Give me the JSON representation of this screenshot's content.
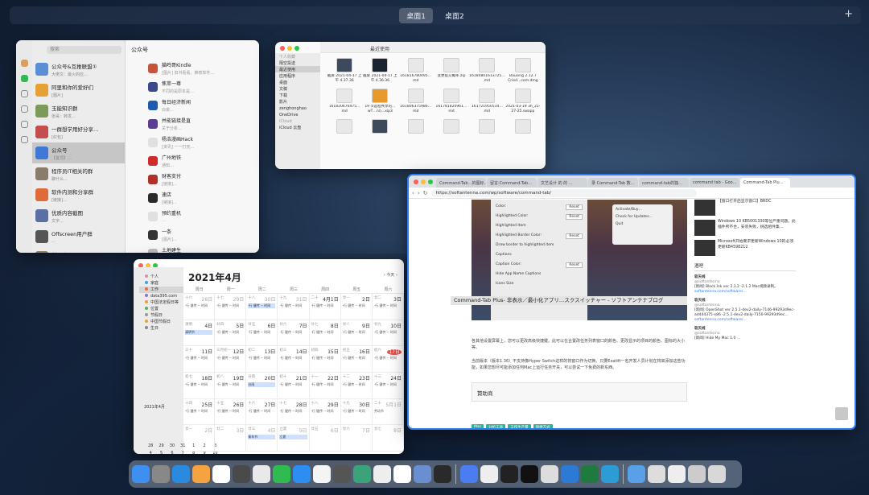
{
  "spaces": {
    "desktop1": "桌面1",
    "desktop2": "桌面2",
    "add": "+"
  },
  "wechat": {
    "search_placeholder": "搜索",
    "header": "公众号",
    "chats": [
      {
        "name": "公众号&互推联盟①",
        "sub": "大佬文：最火的应…",
        "color": "#5a8fd6"
      },
      {
        "name": "阿里和你的爱好们",
        "sub": "[图片]",
        "color": "#e5a136"
      },
      {
        "name": "玉能知识群",
        "sub": "张哥：转发…",
        "color": "#7c9b58"
      },
      {
        "name": "一群想学用好分享…",
        "sub": "[红包]",
        "color": "#c24e4e"
      },
      {
        "name": "公众号",
        "sub": "【置顶】…",
        "color": "#3f79d6"
      },
      {
        "name": "程序员IT相关的群",
        "sub": "聊什么…",
        "color": "#8a7c6a"
      },
      {
        "name": "软件内测和分享群",
        "sub": "[链接]…",
        "color": "#dd6c3a"
      },
      {
        "name": "优质内容截图",
        "sub": "文字…",
        "color": "#5b6fa5"
      },
      {
        "name": "Offscreen用户群",
        "sub": "…",
        "color": "#555"
      },
      {
        "name": "彭亚宇",
        "sub": "http://www.zhihu.com/…",
        "color": "#9a7c5a"
      },
      {
        "name": "GitHub 变更通知",
        "sub": "…",
        "color": "#333"
      }
    ],
    "feed": [
      {
        "name": "猫鸣哥Kindle",
        "sub": "[图片] 旧书看看，推荐软件…",
        "color": "#c4543a"
      },
      {
        "name": "焦萃一尊",
        "sub": "不同的是原本是…",
        "color": "#3a4a8a"
      },
      {
        "name": "每日经济新闻",
        "sub": "白夜…",
        "color": "#1e5bb0"
      },
      {
        "name": "并能链接是直",
        "sub": "关于分析…",
        "color": "#5b3d92"
      },
      {
        "name": "杨浩漫画Hack",
        "sub": "[资讯] 一一打完…",
        "color": "#e0e0e0"
      },
      {
        "name": "广州地铁",
        "sub": "通知…",
        "color": "#d02a2a"
      },
      {
        "name": "财客支付",
        "sub": "[链接]…",
        "color": "#b0312a"
      },
      {
        "name": "速店",
        "sub": "[链接]…",
        "color": "#2a2a2a"
      },
      {
        "name": "预约重机",
        "sub": "…",
        "color": "#e0e0e0"
      },
      {
        "name": "一条",
        "sub": "[图片]…",
        "color": "#333"
      },
      {
        "name": "土地建生",
        "sub": "…",
        "color": "#bbb"
      }
    ]
  },
  "finder": {
    "title": "最近使用",
    "sidebar": [
      {
        "label": "个人收藏",
        "head": true
      },
      {
        "label": "隔空投送"
      },
      {
        "label": "最近使用",
        "sel": true
      },
      {
        "label": "应用程序"
      },
      {
        "label": "桌面"
      },
      {
        "label": "文稿"
      },
      {
        "label": "下载"
      },
      {
        "label": "影片"
      },
      {
        "label": "zenghonghao"
      },
      {
        "label": "OneDrive"
      },
      {
        "label": "iCloud",
        "head": true
      },
      {
        "label": "iCloud 云盘"
      }
    ],
    "files": [
      {
        "name": "截屏 2021-04-17 上午 4.37.36",
        "kind": "img"
      },
      {
        "name": "截屏 2021-04-17 上午 4.36.36",
        "kind": "bk"
      },
      {
        "name": "161816780495…md",
        "kind": "doc"
      },
      {
        "name": "变更提交概率.zip",
        "kind": "doc"
      },
      {
        "name": "16184801613725…md",
        "kind": "doc"
      },
      {
        "name": "Bausing 2.12.7 Cried…com.dmg",
        "kind": "doc"
      },
      {
        "name": "161820676475…md",
        "kind": "doc"
      },
      {
        "name": "19 ②远程共享的…wT…ni)…xip3",
        "kind": "og"
      },
      {
        "name": "161806375986…md",
        "kind": "doc"
      },
      {
        "name": "161781820961…md",
        "kind": "doc"
      },
      {
        "name": "161721950534…md",
        "kind": "doc"
      },
      {
        "name": "2021-03-19 3h_21-27-25.swapp",
        "kind": "doc"
      },
      {
        "name": "",
        "kind": "doc"
      },
      {
        "name": "",
        "kind": "img"
      },
      {
        "name": "",
        "kind": "doc"
      },
      {
        "name": "",
        "kind": "doc"
      },
      {
        "name": "",
        "kind": "doc"
      },
      {
        "name": "",
        "kind": "doc"
      }
    ]
  },
  "browser": {
    "tabs": [
      "Command-Tab…的图标…",
      "留言:Command-Tab…",
      "文艺设计 的 的 …",
      "录 Command-Tab 数…",
      "command-tab的独…",
      "command tab - Goo…",
      "Command-Tab Plu…"
    ],
    "url": "https://softantenna.com/wp/software/command-tab/",
    "dialog": [
      "Color:",
      "Highlighted Color:",
      "Highlighted Item",
      "Highlighted Border Color:",
      "Draw border to highlighted item",
      "Captions",
      "Caption Color:",
      "Hide App Name Captions",
      "Icons Size"
    ],
    "reset": "Reset",
    "menu": [
      "Activate/Buy…",
      "Check for Updates…",
      "Quit"
    ],
    "caption": "Command-Tab Plus- 非表示／最小化アプリ…スクスイッチャー - ソフトアンテナブログ",
    "para1": "各其他设置屏幕上，您可以更改高级快捷键。此可以在合置改任务列表窗口的颜色、更改显示的项目的颜色、图标的大小等。",
    "para2": "当前版本（版本1.36）不支持像Hyper Switch这样的将窗口作为切换。只要Exatift一名开发人员计划在将来添加这些功能，如果您想尽可能添加任何Mac上运行任务开关，可以尝试一下免费的新东西。",
    "link": "Exatift",
    "sponsor": "贊助商",
    "tags": [
      "Mac",
      "分析工具",
      "工作生产量",
      "快捷方式"
    ],
    "sidebar": [
      {
        "txt": "【窗口打开后显示窗口】BRDC"
      },
      {
        "txt": "Windows 10 KB5001330等位严重问题。此插件所不合，安装失败，挑选组件集…"
      },
      {
        "txt": "Microsoft开始要求更新Windows 10的必须更新KB4598212"
      }
    ],
    "recent_head": "酒吧",
    "tweets": [
      {
        "user": "软天线",
        "handle": "@softantenna",
        "text": "[新闻] Block Ink ver 2.1.2 -2.1.2 Mac视频录制。",
        "link": "softantenna.com/software/…"
      },
      {
        "user": "软天线",
        "handle": "@softantenna",
        "text": "[新闻] OpenShot ver 2.5.1-dev2-daily-7146-99293d9ec-ad444375-x86 -2.5.1-dev2-daily-7150-99293d9ec…",
        "link": "softantenna.com/software/…"
      },
      {
        "user": "软天线",
        "handle": "@softantenna",
        "text": "[新闻] Hide My Mac 1.0 …",
        "link": ""
      }
    ]
  },
  "calendar": {
    "title": "2021年4月",
    "today_btn": "今天",
    "sidebar": [
      "个人",
      "家庭",
      "工作",
      "data395.com",
      "中国法定假日等",
      "位置",
      "节假日",
      "中国节假日",
      "生日"
    ],
    "sidebar_colors": [
      "#e28aa0",
      "#3fa0f0",
      "#f06a3a",
      "#9b6bd6",
      "#f09a3a",
      "#5bb05b",
      "#999",
      "#f0a03a",
      "#888"
    ],
    "mini_title": "2021年4月",
    "mini_days": [
      "28",
      "29",
      "30",
      "31",
      "1",
      "2",
      "3",
      "4",
      "5",
      "6",
      "7",
      "8",
      "9",
      "10",
      "11",
      "12",
      "13",
      "14",
      "15",
      "16",
      "17",
      "18",
      "19",
      "20",
      "21",
      "22",
      "23",
      "24",
      "25",
      "26",
      "27",
      "28",
      "29",
      "30",
      "1"
    ],
    "weekdays": [
      "周日",
      "周一",
      "周二",
      "周三",
      "周四",
      "周五",
      "周六"
    ],
    "cells": [
      {
        "d": "28日",
        "l": "十六",
        "out": true,
        "ev": [
          "·行 健传 -- 时间"
        ]
      },
      {
        "d": "29日",
        "l": "十七",
        "out": true,
        "ev": [
          "·行 健传 -- 时间"
        ]
      },
      {
        "d": "30日",
        "l": "十八",
        "out": true,
        "ev": [
          "·行 健传 -- 时间"
        ],
        "hl": true
      },
      {
        "d": "31日",
        "l": "十九",
        "out": true,
        "ev": [
          "·行 健传 -- 时间"
        ]
      },
      {
        "d": "4月1日",
        "l": "二十",
        "ev": [
          "·行 健传 -- 时间"
        ]
      },
      {
        "d": "2日",
        "l": "廿一",
        "ev": [
          "·行 健传 -- 时间"
        ]
      },
      {
        "d": "3日",
        "l": "廿二",
        "ev": [
          "·行 健传 -- 时间"
        ]
      },
      {
        "d": "4日",
        "l": "清明",
        "ev": [
          "清明节"
        ],
        "hl": true
      },
      {
        "d": "5日",
        "l": "廿四",
        "ev": [
          "·行 健传 -- 时间"
        ]
      },
      {
        "d": "6日",
        "l": "廿五",
        "ev": [
          "·行 健传 -- 时间"
        ]
      },
      {
        "d": "7日",
        "l": "廿六",
        "ev": [
          "·行 健传 -- 时间"
        ]
      },
      {
        "d": "8日",
        "l": "廿七",
        "ev": [
          "·行 健传 -- 时间"
        ]
      },
      {
        "d": "9日",
        "l": "廿八",
        "ev": [
          "·行 健传 -- 时间"
        ]
      },
      {
        "d": "10日",
        "l": "廿九",
        "ev": [
          "·行 健传 -- 时间"
        ]
      },
      {
        "d": "11日",
        "l": "三十",
        "ev": [
          "·行 健传 -- 时间"
        ]
      },
      {
        "d": "12日",
        "l": "三月初一",
        "ev": [
          "·行 健传 -- 时间"
        ]
      },
      {
        "d": "13日",
        "l": "初二",
        "ev": [
          "·行 健传 -- 时间"
        ]
      },
      {
        "d": "14日",
        "l": "初三",
        "ev": [
          "·行 健传 -- 时间"
        ]
      },
      {
        "d": "15日",
        "l": "初四",
        "ev": [
          "·行 健传 -- 时间"
        ]
      },
      {
        "d": "16日",
        "l": "初五",
        "ev": [
          "·行 健传 -- 时间"
        ]
      },
      {
        "d": "17日",
        "l": "初六",
        "today": true,
        "ev": [
          "·行 健传 -- 时间"
        ]
      },
      {
        "d": "18日",
        "l": "初七",
        "ev": [
          "·行 健传 -- 时间"
        ]
      },
      {
        "d": "19日",
        "l": "初八",
        "ev": [
          "·行 健传 -- 时间"
        ]
      },
      {
        "d": "20日",
        "l": "谷雨",
        "ev": [
          "谷雨"
        ],
        "hl": true
      },
      {
        "d": "21日",
        "l": "初十",
        "ev": [
          "·行 健传 -- 时间"
        ]
      },
      {
        "d": "22日",
        "l": "十一",
        "ev": [
          "·行 健传 -- 时间"
        ]
      },
      {
        "d": "23日",
        "l": "十二",
        "ev": [
          "·行 健传 -- 时间"
        ]
      },
      {
        "d": "24日",
        "l": "十三",
        "ev": [
          "·行 健传 -- 时间"
        ]
      },
      {
        "d": "25日",
        "l": "十四",
        "ev": [
          "·行 健传 -- 时间"
        ]
      },
      {
        "d": "26日",
        "l": "十五",
        "ev": [
          "·行 健传 -- 时间"
        ]
      },
      {
        "d": "27日",
        "l": "十六",
        "ev": [
          "·行 健传 -- 时间"
        ]
      },
      {
        "d": "28日",
        "l": "十七",
        "ev": [
          "·行 健传 -- 时间"
        ]
      },
      {
        "d": "29日",
        "l": "十八",
        "ev": [
          "·行 健传 -- 时间"
        ]
      },
      {
        "d": "30日",
        "l": "十九",
        "ev": [
          "·行 健传 -- 时间"
        ]
      },
      {
        "d": "5月1日",
        "l": "二十",
        "out": true,
        "ev": [
          "劳动节"
        ]
      },
      {
        "d": "2日",
        "l": "廿一",
        "out": true,
        "ev": [
          ""
        ]
      },
      {
        "d": "3日",
        "l": "廿二",
        "out": true,
        "ev": [
          ""
        ]
      },
      {
        "d": "4日",
        "l": "廿三",
        "out": true,
        "ev": [
          "青年节"
        ],
        "hl": true
      },
      {
        "d": "5日",
        "l": "立夏",
        "out": true,
        "ev": [
          "立夏"
        ],
        "hl": true
      },
      {
        "d": "6日",
        "l": "廿五",
        "out": true,
        "ev": [
          ""
        ]
      },
      {
        "d": "7日",
        "l": "廿六",
        "out": true,
        "ev": [
          ""
        ]
      },
      {
        "d": "8日",
        "l": "廿七",
        "out": true,
        "ev": [
          ""
        ]
      }
    ]
  },
  "dock": {
    "apps": [
      {
        "name": "finder-icon",
        "color": "#3d8ff0"
      },
      {
        "name": "launchpad-icon",
        "color": "#888"
      },
      {
        "name": "safari-icon",
        "color": "#2a8ae0"
      },
      {
        "name": "photos-icon",
        "color": "#f4a340"
      },
      {
        "name": "calendar-icon",
        "color": "#ffffff"
      },
      {
        "name": "app-grid-icon",
        "color": "#4a4a4a"
      },
      {
        "name": "chrome-icon",
        "color": "#e9e9e9"
      },
      {
        "name": "wechat-icon",
        "color": "#2fbb4f"
      },
      {
        "name": "app-store-icon",
        "color": "#2c8ef0"
      },
      {
        "name": "dots-app-icon",
        "color": "#f4f4f4"
      },
      {
        "name": "utility-icon",
        "color": "#555"
      },
      {
        "name": "globe-icon",
        "color": "#3ba37a"
      },
      {
        "name": "cloud-icon",
        "color": "#eee"
      },
      {
        "name": "notion-icon",
        "color": "#fff"
      },
      {
        "name": "preview-icon",
        "color": "#6a8fd0"
      },
      {
        "name": "terminal-icon",
        "color": "#2a2a2a"
      },
      {
        "name": "sep"
      },
      {
        "name": "ticktick-icon",
        "color": "#4a7ef0"
      },
      {
        "name": "reminders-icon",
        "color": "#eee"
      },
      {
        "name": "console-icon",
        "color": "#222"
      },
      {
        "name": "iterm-icon",
        "color": "#111"
      },
      {
        "name": "input-icon",
        "color": "#ddd"
      },
      {
        "name": "vscode-icon",
        "color": "#2a7ad6"
      },
      {
        "name": "excel-icon",
        "color": "#1e7a3e"
      },
      {
        "name": "edge-icon",
        "color": "#2d9bd6"
      },
      {
        "name": "sep"
      },
      {
        "name": "folder-icon",
        "color": "#5aa0e8"
      },
      {
        "name": "window-thumb-icon",
        "color": "#ddd"
      },
      {
        "name": "window-thumb-icon",
        "color": "#eee"
      },
      {
        "name": "window-thumb-icon",
        "color": "#ccc"
      },
      {
        "name": "trash-icon",
        "color": "#d8d8d8"
      }
    ]
  }
}
